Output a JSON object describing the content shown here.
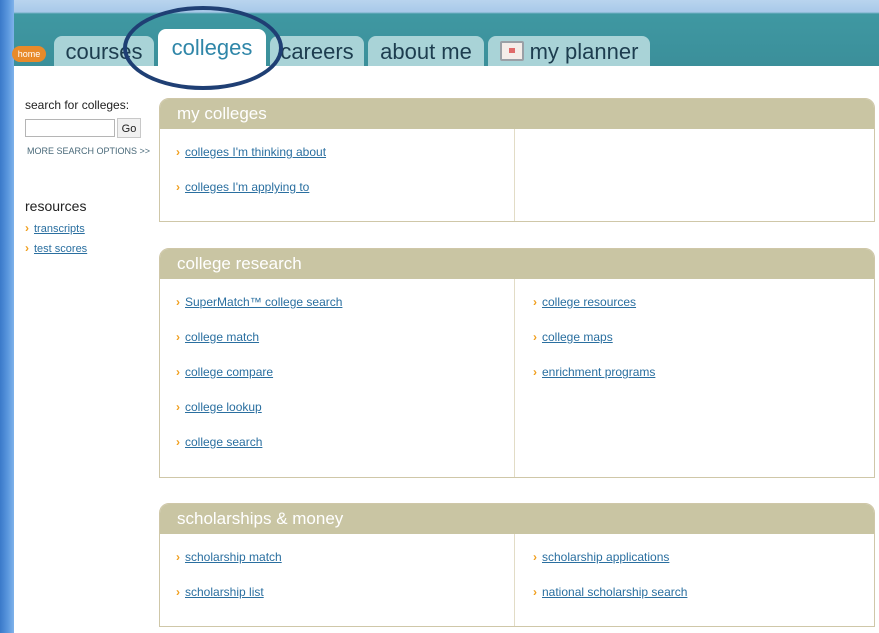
{
  "nav": {
    "home": "home",
    "tabs": [
      "courses",
      "colleges",
      "careers",
      "about me",
      "my planner"
    ]
  },
  "sidebar": {
    "search_label": "search for colleges:",
    "search_value": "",
    "go_label": "Go",
    "more_options": "MORE SEARCH OPTIONS >>",
    "resources_title": "resources",
    "resources": [
      "transcripts",
      "test scores"
    ]
  },
  "panels": {
    "my_colleges": {
      "title": "my colleges",
      "left": [
        "colleges I'm thinking about",
        "colleges I'm applying to"
      ],
      "right": []
    },
    "college_research": {
      "title": "college research",
      "left": [
        "SuperMatch™ college search",
        "college match",
        "college compare",
        "college lookup",
        "college search"
      ],
      "right": [
        "college resources",
        "college maps",
        "enrichment programs"
      ]
    },
    "scholarships": {
      "title": "scholarships & money",
      "left": [
        "scholarship match",
        "scholarship list"
      ],
      "right": [
        "scholarship applications",
        "national scholarship search"
      ]
    }
  },
  "colors": {
    "tab_bg": "#a9d3d7",
    "header_bar": "#3b8f9a",
    "panel_header": "#c9c5a3",
    "link": "#2a6fa0",
    "arrow": "#f0a020",
    "ring": "#1f3f74"
  }
}
